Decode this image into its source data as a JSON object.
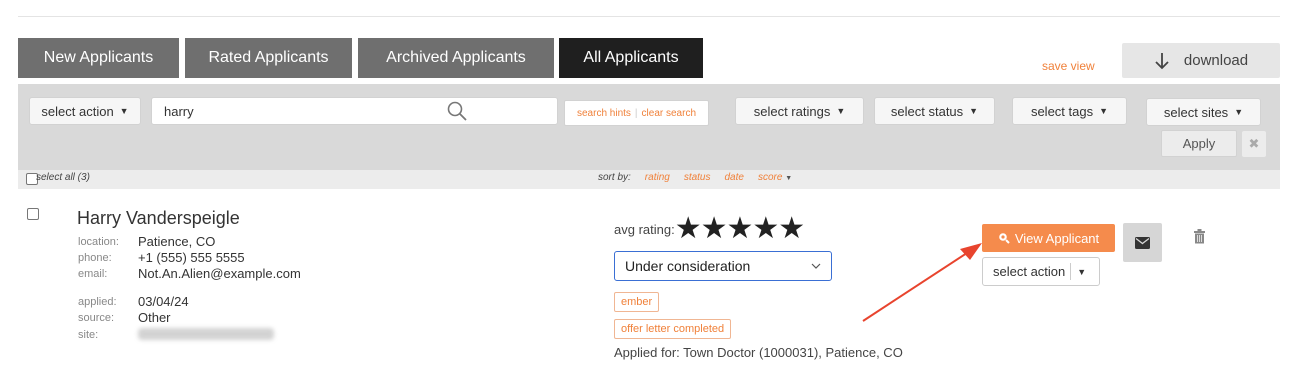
{
  "tabs": [
    {
      "label": "New Applicants",
      "active": false
    },
    {
      "label": "Rated Applicants",
      "active": false
    },
    {
      "label": "Archived Applicants",
      "active": false
    },
    {
      "label": "All Applicants",
      "active": true
    }
  ],
  "header": {
    "save_view": "save view",
    "download": "download"
  },
  "filters": {
    "select_action": "select action",
    "search_value": "harry",
    "search_hints": "search hints",
    "clear_search": "clear search",
    "select_ratings": "select ratings",
    "select_status": "select status",
    "select_tags": "select tags",
    "select_sites": "select sites",
    "apply": "Apply",
    "clear_icon": "✖"
  },
  "list": {
    "select_all": "select all (3)",
    "sort_by": "sort by:",
    "sort_options": [
      "rating",
      "status",
      "date",
      "score"
    ]
  },
  "applicant": {
    "name": "Harry Vanderspeigle",
    "fields": [
      {
        "label": "location:",
        "value": "Patience, CO"
      },
      {
        "label": "phone:",
        "value": "+1 (555) 555 5555"
      },
      {
        "label": "email:",
        "value": "Not.An.Alien@example.com"
      },
      {
        "label": "applied:",
        "value": "03/04/24"
      },
      {
        "label": "source:",
        "value": "Other"
      },
      {
        "label": "site:",
        "value": ""
      }
    ],
    "avg_rating_label": "avg rating:",
    "stars": "★★★★★",
    "rating": 5,
    "status": "Under consideration",
    "tags": [
      "ember",
      "offer letter completed"
    ],
    "applied_for": "Applied for: Town Doctor (1000031), Patience, CO",
    "view_button": "View Applicant",
    "select_action": "select action"
  },
  "colors": {
    "accent": "#f58b4c",
    "link_orange": "#f0813a",
    "annotation_arrow": "#e8442e"
  }
}
